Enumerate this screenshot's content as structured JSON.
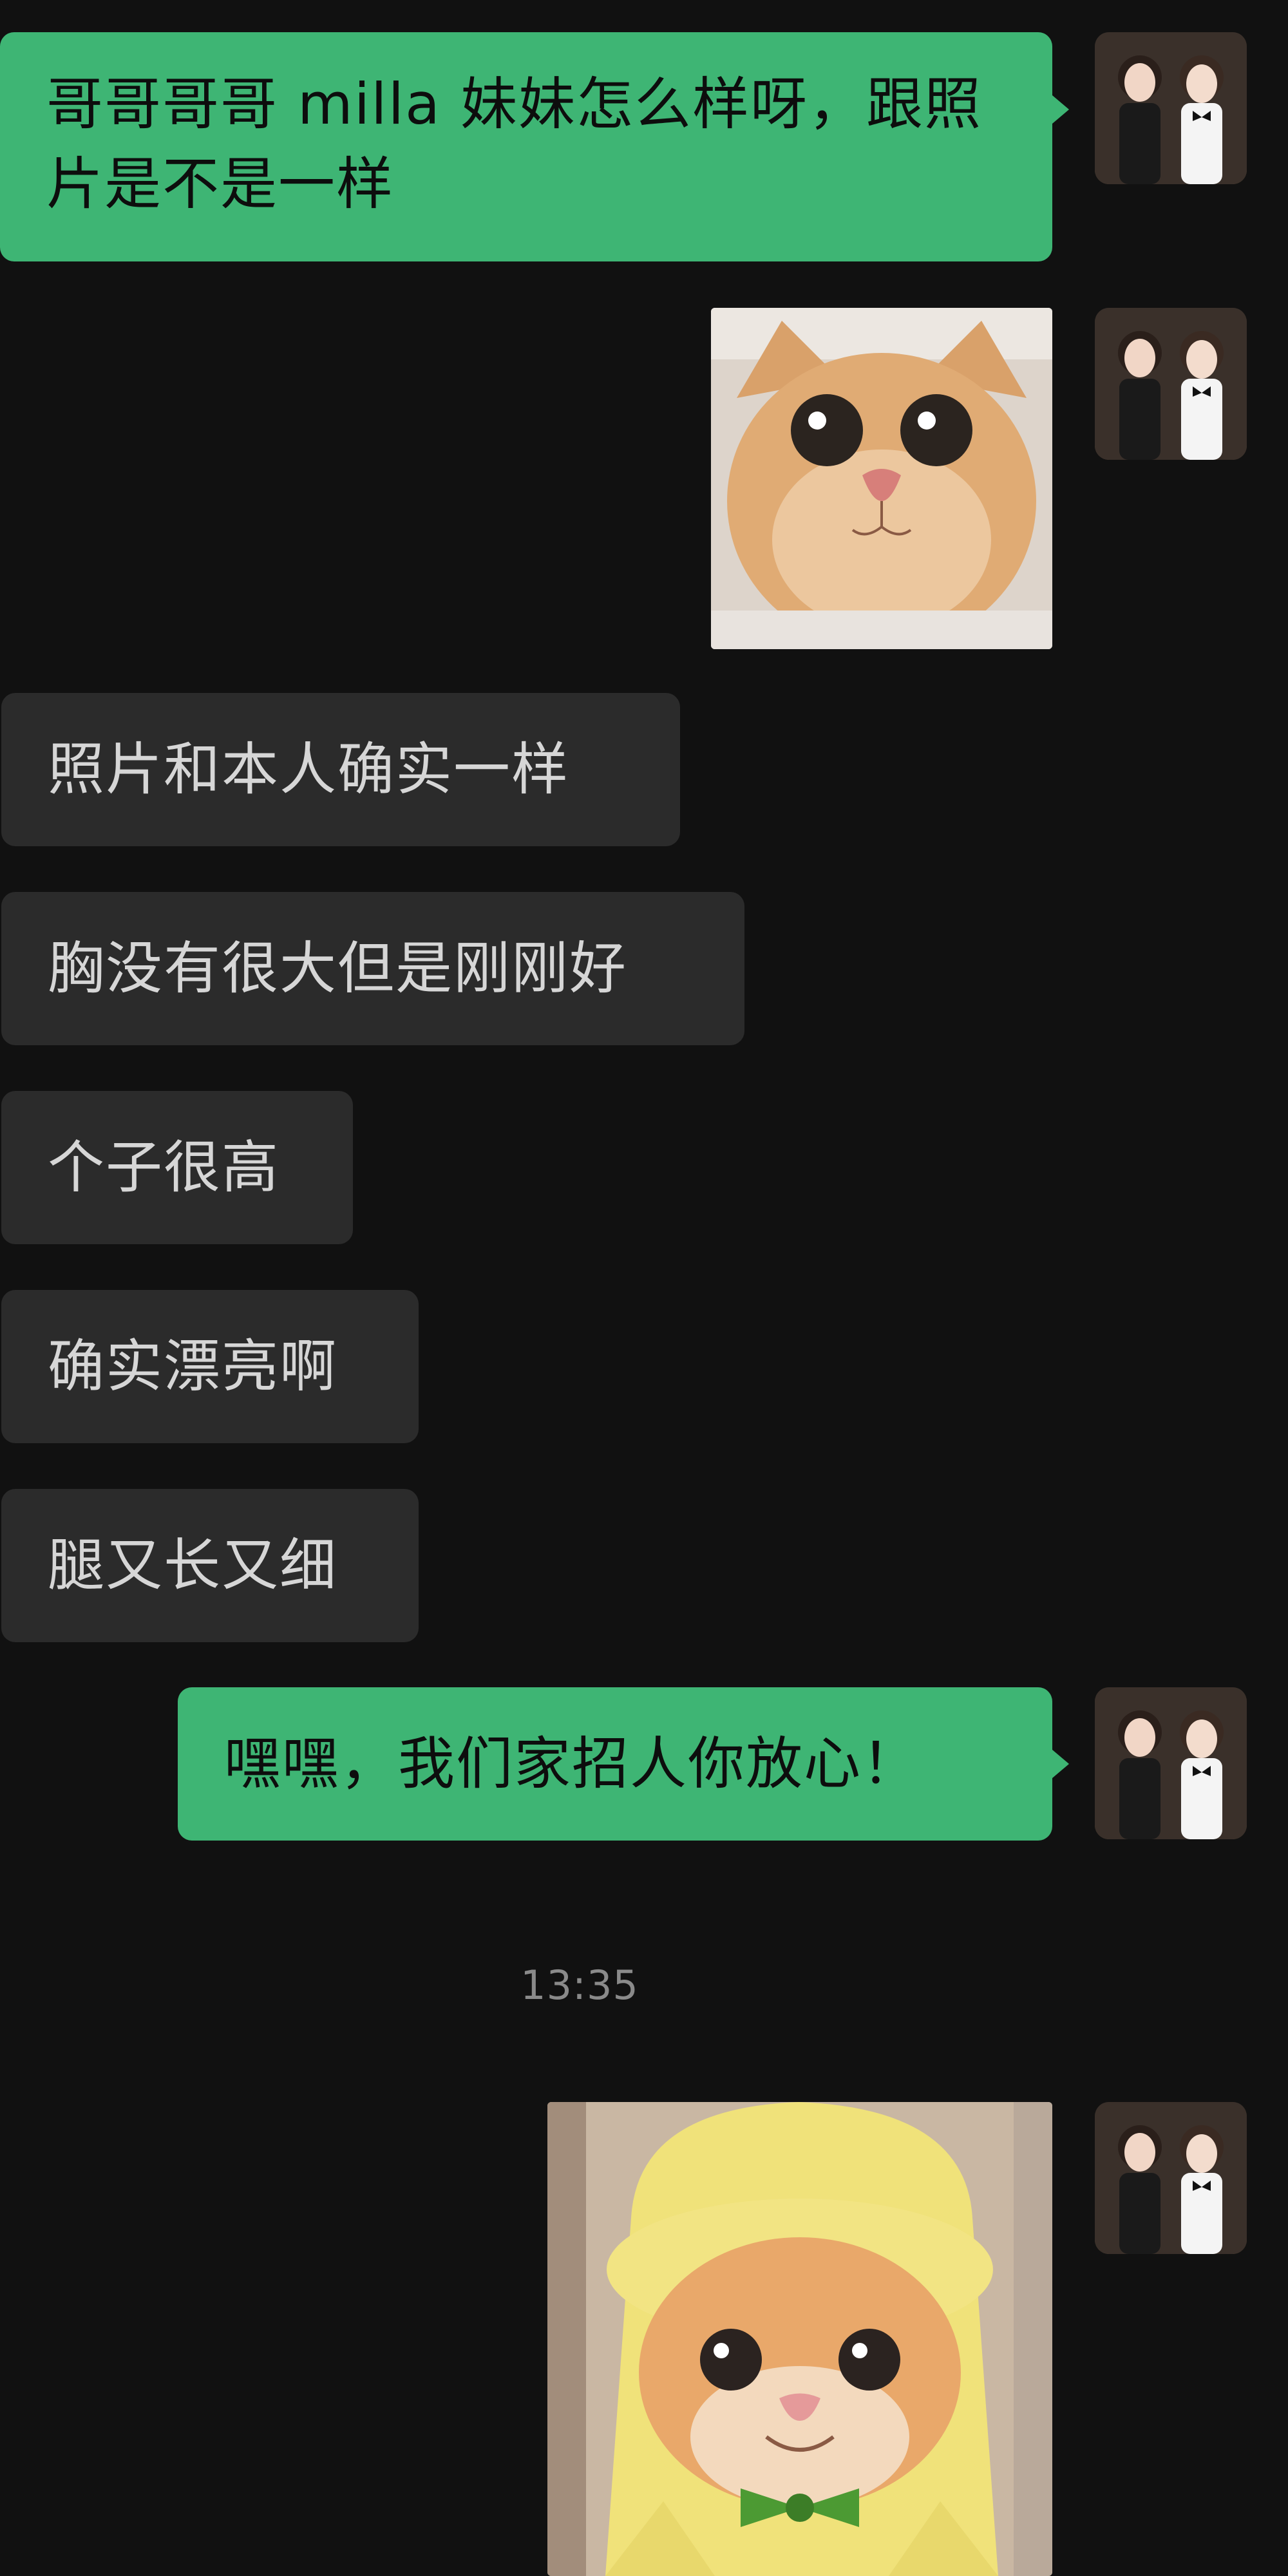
{
  "colors": {
    "background": "#111111",
    "outgoing_bubble": "#3eb574",
    "incoming_bubble": "#2b2b2b",
    "incoming_text": "#d6d6d6",
    "timestamp": "#8a8a8a"
  },
  "messages": {
    "m1": {
      "text": "哥哥哥哥 milla 妹妹怎么样呀，跟照片是不是一样"
    },
    "m2": {
      "image": "cat-closeup-photo"
    },
    "m3": {
      "text": "照片和本人确实一样"
    },
    "m4": {
      "text": "胸没有很大但是刚刚好"
    },
    "m5": {
      "text": "个子很高"
    },
    "m6": {
      "text": "确实漂亮啊"
    },
    "m7": {
      "text": "腿又长又细"
    },
    "m8": {
      "text": "嘿嘿，我们家招人你放心！"
    },
    "m9": {
      "image": "cat-in-banana-costume-photo"
    }
  },
  "timestamp": "13:35",
  "avatar": {
    "icon": "two-girls-avatar-photo"
  }
}
